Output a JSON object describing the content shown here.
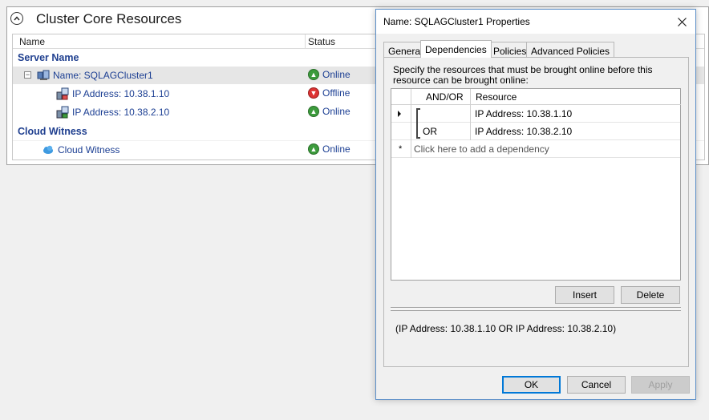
{
  "panel": {
    "title": "Cluster Core Resources",
    "columns": {
      "name": "Name",
      "status": "Status"
    },
    "groups": {
      "server_name": "Server Name",
      "cloud_witness": "Cloud Witness"
    },
    "rows": [
      {
        "name": "Name: SQLAGCluster1",
        "status": "Online"
      },
      {
        "name": "IP Address: 10.38.1.10",
        "status": "Offline"
      },
      {
        "name": "IP Address: 10.38.2.10",
        "status": "Online"
      },
      {
        "name": "Cloud Witness",
        "status": "Online"
      }
    ],
    "tree_toggle": "⊟"
  },
  "dialog": {
    "title": "Name: SQLAGCluster1 Properties",
    "tabs": [
      "General",
      "Dependencies",
      "Policies",
      "Advanced Policies"
    ],
    "active_tab": "Dependencies",
    "instructions": "Specify the resources that must be brought online before this resource can be brought online:",
    "grid": {
      "col_andor": "AND/OR",
      "col_resource": "Resource",
      "rows": [
        {
          "andor": "",
          "resource": "IP Address: 10.38.1.10"
        },
        {
          "andor": "OR",
          "resource": "IP Address: 10.38.2.10"
        }
      ],
      "new_row_marker": "*",
      "add_placeholder": "Click here to add a dependency"
    },
    "insert_label": "Insert",
    "delete_label": "Delete",
    "expression": "(IP Address: 10.38.1.10 OR IP Address: 10.38.2.10)",
    "ok_label": "OK",
    "cancel_label": "Cancel",
    "apply_label": "Apply"
  },
  "colors": {
    "link_blue": "#1c3f93",
    "group_blue": "#1f3f8f",
    "online_green": "#3c9b3c",
    "offline_red": "#dd3333",
    "ok_border": "#0078d7"
  }
}
